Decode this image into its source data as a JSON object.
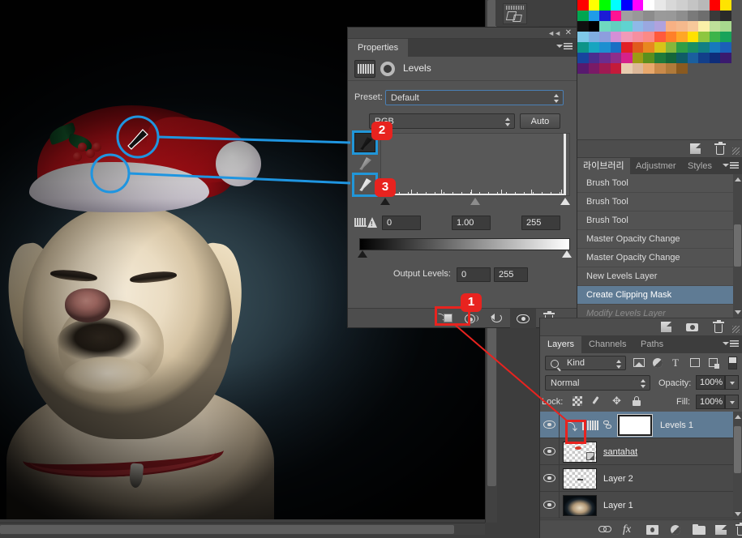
{
  "properties_panel": {
    "tab_label": "Properties",
    "adjustment_title": "Levels",
    "preset_label": "Preset:",
    "preset_value": "Default",
    "channel_value": "RGB",
    "auto_label": "Auto",
    "input_black": "0",
    "input_gamma": "1.00",
    "input_white": "255",
    "output_levels_label": "Output Levels:",
    "output_black": "0",
    "output_white": "255",
    "close_icon": "close-icon",
    "collapse_icon": "collapse-icon",
    "menu_icon": "panel-menu-icon",
    "eyedroppers": [
      {
        "name": "set-black-point-eyedropper",
        "tip": "black"
      },
      {
        "name": "set-gray-point-eyedropper",
        "tip": "gray"
      },
      {
        "name": "set-white-point-eyedropper",
        "tip": "white"
      }
    ],
    "bottom_buttons": [
      {
        "name": "clip-to-layer-button",
        "icon": "clip-to-layer-icon"
      },
      {
        "name": "toggle-previous-state-button",
        "icon": "eye-slash-icon"
      },
      {
        "name": "reset-adjustment-button",
        "icon": "reset-icon"
      },
      {
        "name": "toggle-layer-visibility-button",
        "icon": "eye-icon"
      },
      {
        "name": "delete-adjustment-button",
        "icon": "trash-icon"
      }
    ]
  },
  "history_panel": {
    "tabs": [
      {
        "label": "라이브러리",
        "active": true
      },
      {
        "label": "Adjustmer",
        "active": false
      },
      {
        "label": "Styles",
        "active": false
      }
    ],
    "items": [
      {
        "label": "Brush Tool",
        "state": "past"
      },
      {
        "label": "Brush Tool",
        "state": "past"
      },
      {
        "label": "Brush Tool",
        "state": "past"
      },
      {
        "label": "Master Opacity Change",
        "state": "past"
      },
      {
        "label": "Master Opacity Change",
        "state": "past"
      },
      {
        "label": "New Levels Layer",
        "state": "past"
      },
      {
        "label": "Create Clipping Mask",
        "state": "active"
      },
      {
        "label": "Modify Levels Layer",
        "state": "future"
      }
    ],
    "toolbar": [
      {
        "name": "new-snapshot-button",
        "icon": "new-document-icon"
      },
      {
        "name": "delete-state-button",
        "icon": "trash-icon"
      }
    ]
  },
  "layers_panel": {
    "tabs": [
      {
        "label": "Layers",
        "active": true
      },
      {
        "label": "Channels",
        "active": false
      },
      {
        "label": "Paths",
        "active": false
      }
    ],
    "filter_kind": "Kind",
    "filter_icons": [
      "pixel-layer-filter-icon",
      "adjustment-layer-filter-icon",
      "type-layer-filter-icon",
      "shape-layer-filter-icon",
      "smart-object-filter-icon"
    ],
    "blend_mode": "Normal",
    "opacity_label": "Opacity:",
    "opacity_value": "100%",
    "lock_label": "Lock:",
    "lock_icons": [
      "lock-transparent-pixels-icon",
      "lock-image-pixels-icon",
      "lock-position-icon",
      "lock-all-icon"
    ],
    "fill_label": "Fill:",
    "fill_value": "100%",
    "rows": [
      {
        "name": "Levels 1",
        "type": "adjustment",
        "selected": true,
        "clipped": true,
        "visible": true,
        "underline": false
      },
      {
        "name": "santahat",
        "type": "pixel-smart",
        "selected": false,
        "clipped": false,
        "visible": true,
        "underline": true
      },
      {
        "name": "Layer 2",
        "type": "pixel",
        "selected": false,
        "clipped": false,
        "visible": true,
        "underline": false
      },
      {
        "name": "Layer 1",
        "type": "photo",
        "selected": false,
        "clipped": false,
        "visible": true,
        "underline": false
      }
    ],
    "toolbar": [
      {
        "name": "link-layers-button",
        "icon": "chain-icon"
      },
      {
        "name": "layer-style-button",
        "icon": "fx-icon"
      },
      {
        "name": "add-layer-mask-button",
        "icon": "mask-icon"
      },
      {
        "name": "new-adjustment-layer-button",
        "icon": "adjustment-circle-icon"
      },
      {
        "name": "new-group-button",
        "icon": "folder-icon"
      },
      {
        "name": "new-layer-button",
        "icon": "new-layer-icon"
      },
      {
        "name": "delete-layer-button",
        "icon": "trash-icon"
      }
    ],
    "top_toolbar": [
      {
        "name": "share-button",
        "icon": "share-icon"
      },
      {
        "name": "snapshot-button",
        "icon": "camera-icon"
      },
      {
        "name": "delete-button",
        "icon": "trash-icon"
      }
    ]
  },
  "swatches_panel": {
    "dock_icon": "swatches-dock-icon",
    "colors": [
      "#ff0000",
      "#ffff00",
      "#00ff00",
      "#00ffff",
      "#0000ff",
      "#ff00ff",
      "#ffffff",
      "#e8e8e8",
      "#d8d8d8",
      "#cfcfcf",
      "#c4c4c4",
      "#b8b8b8",
      "#ff0000",
      "#ffe400",
      "#00a651",
      "#1f9ce8",
      "#1b1bd6",
      "#ff1493",
      "#a0a0a0",
      "#989898",
      "#8c8c8c",
      "#9a9a9a",
      "#999999",
      "#8e8e8e",
      "#7a7a7a",
      "#6e6e6e",
      "#3a3a3a",
      "#2a2a2a",
      "#101010",
      "#000000",
      "#6fd8c0",
      "#62cfc0",
      "#5fd3d0",
      "#8fb9e8",
      "#9aa8e0",
      "#b0a2dd",
      "#f7b184",
      "#f5b98d",
      "#f7c89a",
      "#faf0a8",
      "#bfe09a",
      "#a8d98e",
      "#7ec8e8",
      "#7faee0",
      "#8d9ede",
      "#d48fd6",
      "#f09ab8",
      "#f58fa0",
      "#fb8a86",
      "#ff5a3c",
      "#ff7f29",
      "#ffa626",
      "#ffe100",
      "#8ec63f",
      "#3cb44a",
      "#18a35a",
      "#0d9488",
      "#17a5c0",
      "#1d8fd0",
      "#1a6fc4",
      "#e01f26",
      "#e05a1d",
      "#e8871f",
      "#d8c319",
      "#86b73a",
      "#2f9e45",
      "#1a8f62",
      "#127f84",
      "#1779bd",
      "#1b5fb8",
      "#17449e",
      "#4a2d8f",
      "#6b2d8f",
      "#8f2d8a",
      "#d6218a",
      "#9e9a14",
      "#5a8f1d",
      "#1f7a3a",
      "#14663a",
      "#0f5c66",
      "#1a5f9e",
      "#123f8a",
      "#0e2d7a",
      "#3a1a6e",
      "#571a6e",
      "#7a1a66",
      "#9e1a52",
      "#c41a3a",
      "#e8cdb0",
      "#dcb899",
      "#e8a86c",
      "#c98a4a",
      "#b07a3a",
      "#8a5a20"
    ]
  },
  "annotations": [
    {
      "id": "1",
      "label": "1",
      "target": "clip-to-layer-button"
    },
    {
      "id": "2",
      "label": "2",
      "target": "set-black-point-eyedropper"
    },
    {
      "id": "3",
      "label": "3",
      "target": "set-white-point-eyedropper"
    }
  ],
  "canvas": {
    "subject": "labrador-dog-wearing-santa-hat",
    "callout_color": "#1f95e0",
    "highlight_color": "#e8231f"
  }
}
